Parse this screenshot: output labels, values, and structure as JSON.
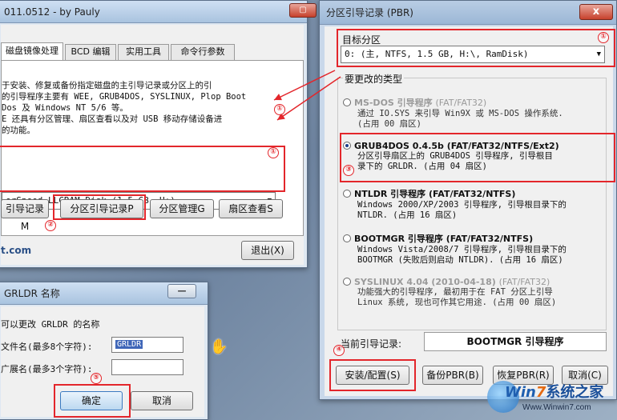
{
  "main_window": {
    "title": "011.0512 - by Pauly",
    "tabs": [
      "磁盘镜像处理",
      "BCD 编辑",
      "实用工具",
      "命令行参数"
    ],
    "description_lines": [
      "于安装、修复或备份指定磁盘的主引导记录或分区上的引",
      "的引导程序主要有 WEE, GRUB4DOS, SYSLINUX, Plop Boot",
      "Dos 及 Windows NT 5/6 等。",
      "E 还具有分区管理、扇区查看以及对 USB 移动存储设备进",
      "的功能。"
    ],
    "disk_select": "erSpeed_LLCRAM_Disk (1.5 GB, H:)",
    "buttons": [
      "引导记录M",
      "分区引导记录P",
      "分区管理G",
      "扇区查看S"
    ],
    "site_text": "t.com",
    "exit_button": "退出(X)"
  },
  "rename_dialog": {
    "title": "GRLDR 名称",
    "intro": "可以更改 GRLDR 的名称",
    "filename_label": "文件名(最多8个字符):",
    "filename_value": "GRLDR",
    "ext_label": "广展名(最多3个字符):",
    "ext_value": "",
    "ok_button": "确定",
    "cancel_button": "取消"
  },
  "pbr_window": {
    "title": "分区引导记录 (PBR)",
    "close_label": "x",
    "target_label": "目标分区",
    "target_value": "0:  (主,    NTFS,    1.5 GB, H:\\, RamDisk)",
    "type_label": "要更改的类型",
    "options": [
      {
        "name": "MS-DOS 引导程序",
        "tag": "(FAT/FAT32)",
        "desc": [
          "通过 IO.SYS 来引导 Win9X 或 MS-DOS 操作系统.",
          "(占用 00 扇区)"
        ],
        "state": "disabled"
      },
      {
        "name": "GRUB4DOS 0.4.5b",
        "tag": "(FAT/FAT32/NTFS/Ext2)",
        "desc": [
          "分区引导扇区上的 GRUB4DOS 引导程序, 引导根目",
          "录下的 GRLDR. (占用 04 扇区)"
        ],
        "state": "selected"
      },
      {
        "name": "NTLDR 引导程序",
        "tag": "(FAT/FAT32/NTFS)",
        "desc": [
          "Windows 2000/XP/2003 引导程序, 引导根目录下的",
          "NTLDR. (占用 16 扇区)"
        ],
        "state": "normal"
      },
      {
        "name": "BOOTMGR 引导程序",
        "tag": "(FAT/FAT32/NTFS)",
        "desc": [
          "Windows Vista/2008/7 引导程序, 引导根目录下的",
          "BOOTMGR (失败后则启动 NTLDR). (占用 16 扇区)"
        ],
        "state": "normal"
      },
      {
        "name": "SYSLINUX 4.04 (2010-04-18)",
        "tag": "(FAT/FAT32)",
        "desc": [
          "功能强大的引导程序, 最初用于在 FAT 分区上引导",
          "Linux 系统, 现也可作其它用途. (占用 00 扇区)"
        ],
        "state": "disabled"
      }
    ],
    "current_label": "当前引导记录:",
    "current_value": "BOOTMGR 引导程序",
    "buttons": [
      "安装/配置(S)",
      "备份PBR(B)",
      "恢复PBR(R)",
      "取消(C)"
    ]
  },
  "annotations": [
    "①",
    "①",
    "②",
    "①",
    "③",
    "④",
    "⑤"
  ],
  "watermark": {
    "brand_a": "Win",
    "brand_b": "7",
    "brand_c": "系统之家",
    "url": "Www.Winwin7.com"
  },
  "colors": {
    "highlight": "#e3262b",
    "arrow": "#e3262b",
    "selection": "#1a3d8a"
  }
}
